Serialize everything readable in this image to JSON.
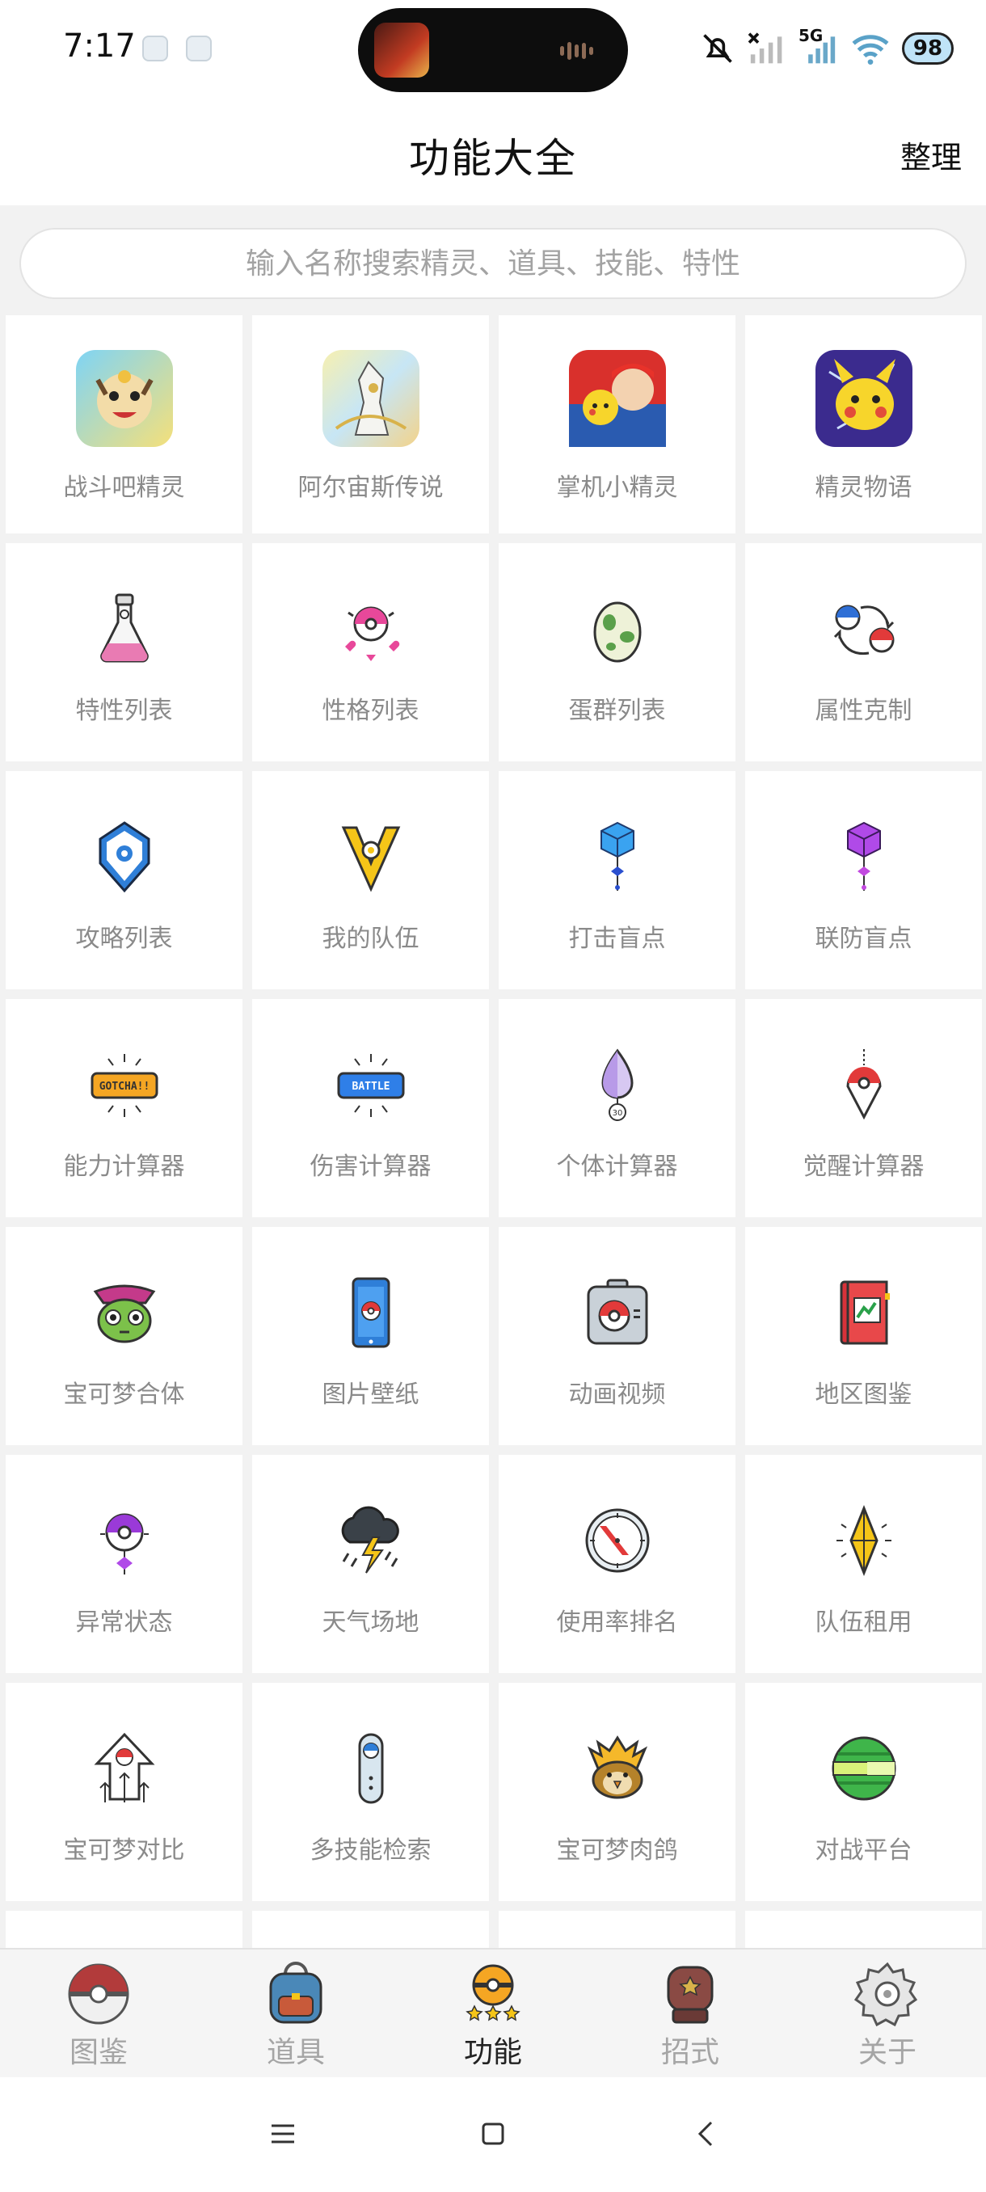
{
  "status_bar": {
    "time": "7:17",
    "network": "5G",
    "battery": "98"
  },
  "header": {
    "title": "功能大全",
    "sort_label": "整理"
  },
  "search": {
    "placeholder": "输入名称搜索精灵、道具、技能、特性"
  },
  "grid": {
    "items": [
      {
        "label": "战斗吧精灵",
        "icon": "meowth-app-icon"
      },
      {
        "label": "阿尔宙斯传说",
        "icon": "arceus-app-icon"
      },
      {
        "label": "掌机小精灵",
        "icon": "ash-pikachu-app-icon"
      },
      {
        "label": "精灵物语",
        "icon": "pikachu-app-icon"
      },
      {
        "label": "特性列表",
        "icon": "flask-icon"
      },
      {
        "label": "性格列表",
        "icon": "hearts-pokeball-icon"
      },
      {
        "label": "蛋群列表",
        "icon": "egg-icon"
      },
      {
        "label": "属性克制",
        "icon": "type-arrows-icon"
      },
      {
        "label": "攻略列表",
        "icon": "shield-icon"
      },
      {
        "label": "我的队伍",
        "icon": "team-badge-icon"
      },
      {
        "label": "打击盲点",
        "icon": "blue-cube-icon"
      },
      {
        "label": "联防盲点",
        "icon": "purple-cube-icon"
      },
      {
        "label": "能力计算器",
        "icon": "gotcha-sign-icon"
      },
      {
        "label": "伤害计算器",
        "icon": "battle-sign-icon"
      },
      {
        "label": "个体计算器",
        "icon": "iv-drop-icon"
      },
      {
        "label": "觉醒计算器",
        "icon": "pokeball-pin-icon"
      },
      {
        "label": "宝可梦合体",
        "icon": "caterpie-icon"
      },
      {
        "label": "图片壁纸",
        "icon": "phone-icon"
      },
      {
        "label": "动画视频",
        "icon": "camera-icon"
      },
      {
        "label": "地区图鉴",
        "icon": "pokedex-book-icon"
      },
      {
        "label": "异常状态",
        "icon": "status-ball-icon"
      },
      {
        "label": "天气场地",
        "icon": "weather-storm-icon"
      },
      {
        "label": "使用率排名",
        "icon": "compass-icon"
      },
      {
        "label": "队伍租用",
        "icon": "crystal-icon"
      },
      {
        "label": "宝可梦对比",
        "icon": "compare-arrows-icon"
      },
      {
        "label": "多技能检索",
        "icon": "tag-search-icon"
      },
      {
        "label": "宝可梦肉鸽",
        "icon": "pidgeot-icon"
      },
      {
        "label": "对战平台",
        "icon": "green-ball-icon"
      }
    ]
  },
  "bottom_nav": {
    "items": [
      {
        "label": "图鉴",
        "icon": "pokeball-nav-icon"
      },
      {
        "label": "道具",
        "icon": "backpack-nav-icon"
      },
      {
        "label": "功能",
        "icon": "functions-nav-icon",
        "active": true
      },
      {
        "label": "招式",
        "icon": "boxing-glove-nav-icon"
      },
      {
        "label": "关于",
        "icon": "settings-nav-icon"
      }
    ]
  },
  "colors": {
    "background": "#f2f2f2",
    "label_gray": "#8a8a8a",
    "active_text": "#222222"
  }
}
